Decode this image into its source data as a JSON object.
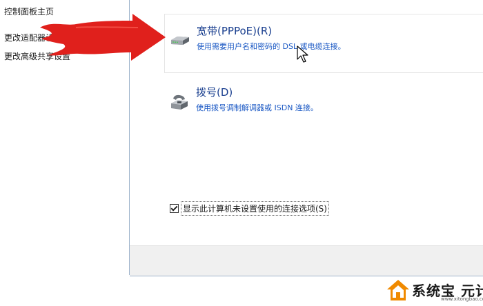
{
  "left_nav": {
    "home": "控制面板主页",
    "change_adapter": "更改适配器设置",
    "change_sharing": "更改高级共享设置"
  },
  "options": [
    {
      "title": "宽带(PPPoE)(R)",
      "description": "使用需要用户名和密码的 DSL 或电缆连接。",
      "icon": "broadband-modem-icon",
      "selected": true
    },
    {
      "title": "拨号(D)",
      "description": "使用拨号调制解调器或 ISDN 连接。",
      "icon": "dialup-phone-icon",
      "selected": false
    }
  ],
  "checkbox": {
    "label": "显示此计算机未设置使用的连接选项(S)",
    "checked": true
  },
  "watermark": {
    "text": "系统宝 元计算",
    "url": "www.xitongbao.com"
  },
  "colors": {
    "link_title": "#1a3f8f",
    "link_desc": "#1a58c4",
    "arrow": "#e0201c",
    "divider": "#9fb4cc",
    "footer": "#f0f0f0",
    "watermark_logo": "#f08a00"
  }
}
